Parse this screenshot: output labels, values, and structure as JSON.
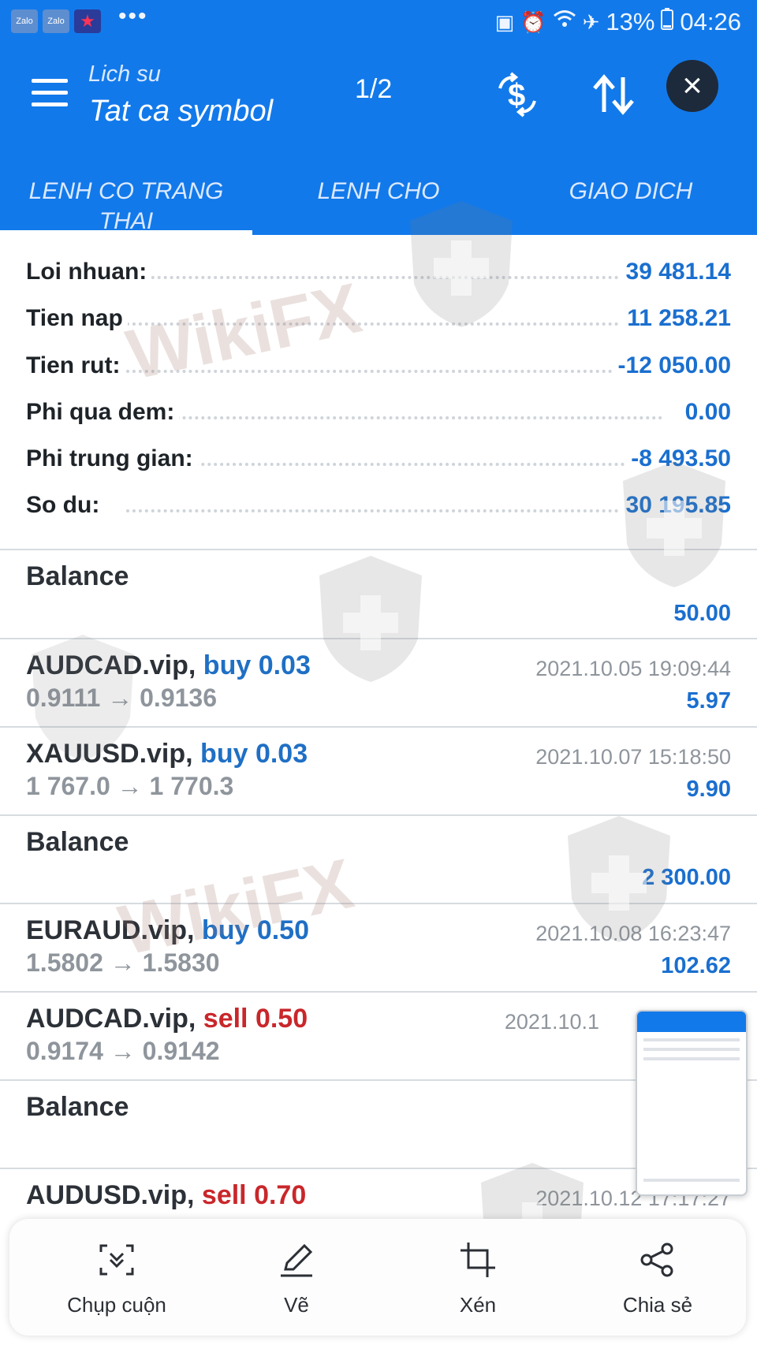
{
  "status_bar": {
    "apps": [
      "Zalo",
      "Zalo"
    ],
    "dots": "•••",
    "battery": "13%",
    "time": "04:26"
  },
  "header": {
    "subtitle": "Lich su",
    "title": "Tat ca symbol",
    "page_indicator": "1/2",
    "icons": [
      "menu-icon",
      "currency-exchange-icon",
      "sort-icon",
      "close-icon"
    ]
  },
  "tabs": [
    {
      "label": "LENH CO TRANG THAI",
      "active": true
    },
    {
      "label": "LENH CHO",
      "active": false
    },
    {
      "label": "GIAO DICH",
      "active": false
    }
  ],
  "summary": [
    {
      "label": "Loi nhuan:",
      "value": "39 481.14"
    },
    {
      "label": "Tien nap",
      "value": "11 258.21"
    },
    {
      "label": "Tien rut:",
      "value": "-12 050.00"
    },
    {
      "label": "Phi qua dem:",
      "value": "0.00"
    },
    {
      "label": "Phi trung gian:",
      "value": "-8 493.50"
    },
    {
      "label": "So du:",
      "value": "30 195.85"
    }
  ],
  "entries": [
    {
      "type": "balance",
      "name": "Balance",
      "date": "",
      "profit": "50.00"
    },
    {
      "type": "trade",
      "symbol": "AUDCAD.vip,",
      "direction": "buy",
      "volume": "buy 0.03",
      "prices": "0.9111 → 0.9136",
      "date": "2021.10.05 19:09:44",
      "profit": "5.97"
    },
    {
      "type": "trade",
      "symbol": "XAUUSD.vip,",
      "direction": "buy",
      "volume": "buy 0.03",
      "prices": "1 767.0 → 1 770.3",
      "date": "2021.10.07 15:18:50",
      "profit": "9.90"
    },
    {
      "type": "balance",
      "name": "Balance",
      "date": "",
      "profit": "2 300.00"
    },
    {
      "type": "trade",
      "symbol": "EURAUD.vip,",
      "direction": "buy",
      "volume": "buy 0.50",
      "prices": "1.5802 → 1.5830",
      "date": "2021.10.08 16:23:47",
      "profit": "102.62"
    },
    {
      "type": "trade",
      "symbol": "AUDCAD.vip,",
      "direction": "sell",
      "volume": "sell 0.50",
      "prices": "0.9174 → 0.9142",
      "date": "2021.10.1",
      "profit": ""
    },
    {
      "type": "balance",
      "name": "Balance",
      "date": "",
      "profit": ""
    },
    {
      "type": "trade",
      "symbol": "AUDUSD.vip,",
      "direction": "sell",
      "volume": "sell 0.70",
      "prices": "",
      "date": "2021.10.12 17:17:27",
      "profit": ""
    }
  ],
  "watermark": "WikiFX",
  "share_bar": {
    "items": [
      {
        "label": "Chụp cuộn",
        "icon": "scroll-capture-icon"
      },
      {
        "label": "Vẽ",
        "icon": "draw-icon"
      },
      {
        "label": "Xén",
        "icon": "crop-icon"
      },
      {
        "label": "Chia sẻ",
        "icon": "share-icon"
      }
    ]
  },
  "colors": {
    "header_blue": "#1279ea",
    "value_blue": "#1a6fcf",
    "buy_blue": "#1f6fc5",
    "sell_red": "#c9272b"
  }
}
